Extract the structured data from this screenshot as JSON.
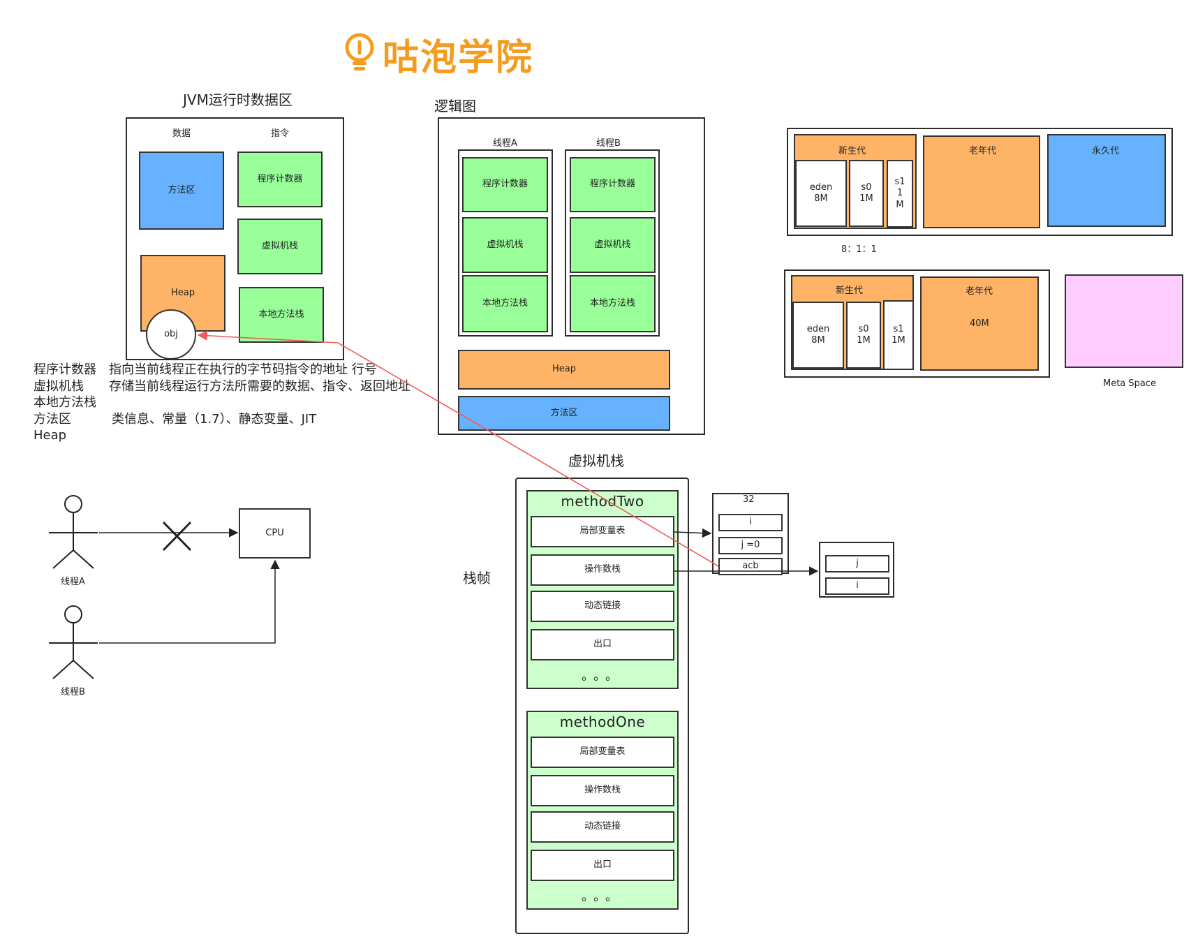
{
  "logo": {
    "text": "咕泡学院"
  },
  "jvm": {
    "title": "JVM运行时数据区",
    "data_header": "数据",
    "instr_header": "指令",
    "method_area": "方法区",
    "heap": "Heap",
    "obj": "obj",
    "pc": "程序计数器",
    "vm_stack": "虚拟机栈",
    "native_stack": "本地方法栈"
  },
  "definitions": [
    {
      "term": "程序计数器",
      "desc": "指向当前线程正在执行的字节码指令的地址   行号"
    },
    {
      "term": "虚拟机栈",
      "desc": "存储当前线程运行方法所需要的数据、指令、返回地址"
    },
    {
      "term": "本地方法栈",
      "desc": ""
    },
    {
      "term": "方法区",
      "desc": "类信息、常量（1.7）、静态变量、JIT"
    },
    {
      "term": "Heap",
      "desc": ""
    }
  ],
  "logic": {
    "title": "逻辑图",
    "thread_a": "线程A",
    "thread_b": "线程B",
    "pc": "程序计数器",
    "vm_stack": "虚拟机栈",
    "native_stack": "本地方法栈",
    "heap": "Heap",
    "method_area": "方法区"
  },
  "memory1": {
    "young": "新生代",
    "old": "老年代",
    "perm": "永久代",
    "eden": "eden\n8M",
    "s0": "s0\n1M",
    "s1": "s1\n1\nM",
    "ratio": "8：1：1"
  },
  "memory2": {
    "young": "新生代",
    "old": "老年代",
    "old_size": "40M",
    "eden": "eden\n8M",
    "s0": "s0\n1M",
    "s1": "s1\n1M",
    "meta": "Meta Space"
  },
  "threads": {
    "a": "线程A",
    "b": "线程B",
    "cpu": "CPU"
  },
  "vmstack": {
    "title": "虚拟机栈",
    "frame_label": "栈帧",
    "method_two": "methodTwo",
    "method_one": "methodOne",
    "locals": "局部变量表",
    "operand": "操作数栈",
    "dynamic_link": "动态链接",
    "exit": "出口",
    "dots": "。。。",
    "local_vars": {
      "header": "32",
      "i": "i",
      "j": "j =0",
      "acb": "acb"
    },
    "operands": {
      "j": "j",
      "i": "i"
    }
  },
  "colors": {
    "green": "#99ff99",
    "blue": "#66b2ff",
    "orange": "#ffb366",
    "pink": "#ffccff",
    "light_green": "#ccffcc",
    "logo": "#f39c1f",
    "arrow_red": "#f15a5a"
  }
}
